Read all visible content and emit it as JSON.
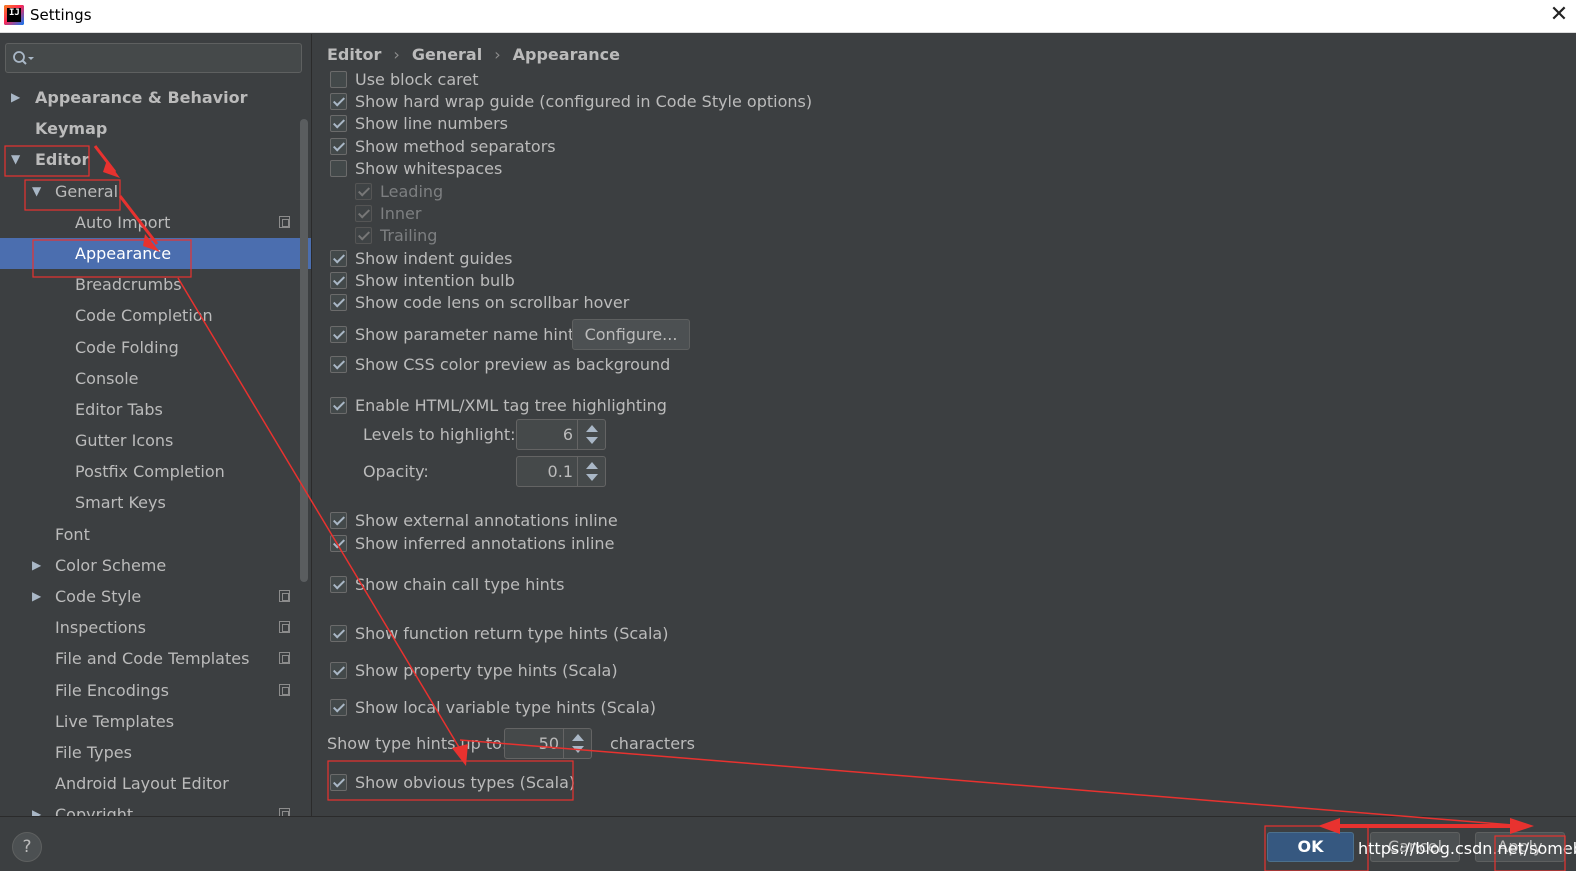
{
  "window": {
    "title": "Settings",
    "app_icon": "intellij-idea-icon",
    "close_icon": "close-icon"
  },
  "search": {
    "placeholder": "",
    "icon": "search-icon"
  },
  "sidebar": {
    "items": [
      {
        "label": "Appearance & Behavior",
        "arrow": "▶",
        "bold": true,
        "copy_icon": false
      },
      {
        "label": "Keymap",
        "arrow": "",
        "bold": true,
        "copy_icon": false
      },
      {
        "label": "Editor",
        "arrow": "▼",
        "bold": true,
        "copy_icon": false
      },
      {
        "label": "General",
        "arrow": "▼",
        "bold": false,
        "copy_icon": false
      },
      {
        "label": "Auto Import",
        "arrow": "",
        "bold": false,
        "copy_icon": true
      },
      {
        "label": "Appearance",
        "arrow": "",
        "bold": false,
        "copy_icon": false,
        "selected": true
      },
      {
        "label": "Breadcrumbs",
        "arrow": "",
        "bold": false,
        "copy_icon": false
      },
      {
        "label": "Code Completion",
        "arrow": "",
        "bold": false,
        "copy_icon": false
      },
      {
        "label": "Code Folding",
        "arrow": "",
        "bold": false,
        "copy_icon": false
      },
      {
        "label": "Console",
        "arrow": "",
        "bold": false,
        "copy_icon": false
      },
      {
        "label": "Editor Tabs",
        "arrow": "",
        "bold": false,
        "copy_icon": false
      },
      {
        "label": "Gutter Icons",
        "arrow": "",
        "bold": false,
        "copy_icon": false
      },
      {
        "label": "Postfix Completion",
        "arrow": "",
        "bold": false,
        "copy_icon": false
      },
      {
        "label": "Smart Keys",
        "arrow": "",
        "bold": false,
        "copy_icon": false
      },
      {
        "label": "Font",
        "arrow": "",
        "bold": false,
        "copy_icon": false
      },
      {
        "label": "Color Scheme",
        "arrow": "▶",
        "bold": false,
        "copy_icon": false
      },
      {
        "label": "Code Style",
        "arrow": "▶",
        "bold": false,
        "copy_icon": true
      },
      {
        "label": "Inspections",
        "arrow": "",
        "bold": false,
        "copy_icon": true
      },
      {
        "label": "File and Code Templates",
        "arrow": "",
        "bold": false,
        "copy_icon": true
      },
      {
        "label": "File Encodings",
        "arrow": "",
        "bold": false,
        "copy_icon": true
      },
      {
        "label": "Live Templates",
        "arrow": "",
        "bold": false,
        "copy_icon": false
      },
      {
        "label": "File Types",
        "arrow": "",
        "bold": false,
        "copy_icon": false
      },
      {
        "label": "Android Layout Editor",
        "arrow": "",
        "bold": false,
        "copy_icon": false
      },
      {
        "label": "Copyright",
        "arrow": "▶",
        "bold": false,
        "copy_icon": true
      }
    ]
  },
  "breadcrumb": {
    "items": [
      "Editor",
      "General",
      "Appearance"
    ],
    "separator": "›"
  },
  "options": {
    "use_block_caret": {
      "label": "Use block caret",
      "checked": false
    },
    "hard_wrap": {
      "label": "Show hard wrap guide (configured in Code Style options)",
      "checked": true
    },
    "line_numbers": {
      "label": "Show line numbers",
      "checked": true
    },
    "method_separators": {
      "label": "Show method separators",
      "checked": true
    },
    "whitespaces": {
      "label": "Show whitespaces",
      "checked": false
    },
    "leading": {
      "label": "Leading",
      "checked": true
    },
    "inner": {
      "label": "Inner",
      "checked": true
    },
    "trailing": {
      "label": "Trailing",
      "checked": true
    },
    "indent_guides": {
      "label": "Show indent guides",
      "checked": true
    },
    "intention_bulb": {
      "label": "Show intention bulb",
      "checked": true
    },
    "code_lens": {
      "label": "Show code lens on scrollbar hover",
      "checked": true
    },
    "param_hints": {
      "label": "Show parameter name hints",
      "checked": true
    },
    "css_preview": {
      "label": "Show CSS color preview as background",
      "checked": true
    },
    "tag_tree": {
      "label": "Enable HTML/XML tag tree highlighting",
      "checked": true
    },
    "ext_annotations": {
      "label": "Show external annotations inline",
      "checked": true
    },
    "inferred_annotations": {
      "label": "Show inferred annotations inline",
      "checked": true
    },
    "chain_call": {
      "label": "Show chain call type hints",
      "checked": true
    },
    "func_return": {
      "label": "Show function return type hints (Scala)",
      "checked": true
    },
    "property_type": {
      "label": "Show property type hints (Scala)",
      "checked": true
    },
    "local_var": {
      "label": "Show local variable type hints (Scala)",
      "checked": true
    },
    "obvious_types": {
      "label": "Show obvious types (Scala)",
      "checked": true
    }
  },
  "configure_button": "Configure...",
  "levels": {
    "label": "Levels to highlight:",
    "value": "6"
  },
  "opacity": {
    "label": "Opacity:",
    "value": "0.1"
  },
  "type_hints": {
    "label": "Show type hints up to:",
    "value": "50",
    "suffix": "characters"
  },
  "footer": {
    "help": "?",
    "ok": "OK",
    "cancel": "Cancel",
    "apply": "Apply",
    "watermark": "https://blog.csdn.net/someby"
  },
  "annotation_color": "#e8322f"
}
